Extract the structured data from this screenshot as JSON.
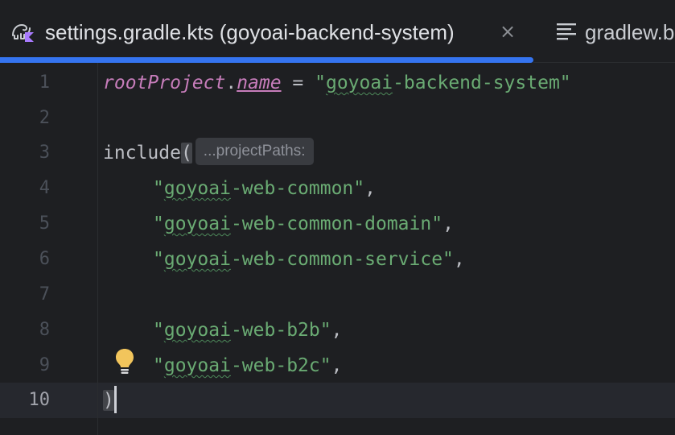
{
  "tabs": [
    {
      "title": "settings.gradle.kts (goyoai-backend-system)",
      "icon": "gradle-kotlin-icon",
      "active": true,
      "close": "×"
    },
    {
      "title": "gradlew.bat",
      "icon": "text-lines-icon",
      "active": false
    }
  ],
  "editor": {
    "current_line": 10,
    "lines": [
      {
        "number": "1"
      },
      {
        "number": "2"
      },
      {
        "number": "3"
      },
      {
        "number": "4"
      },
      {
        "number": "5"
      },
      {
        "number": "6"
      },
      {
        "number": "7"
      },
      {
        "number": "8"
      },
      {
        "number": "9"
      },
      {
        "number": "10"
      }
    ],
    "code": {
      "line1": {
        "root": "rootProject",
        "dot": ".",
        "prop": "name",
        "op": " = ",
        "str_open": "\"",
        "str_squig": "goyoai",
        "str_rest": "-backend-system\""
      },
      "line3": {
        "fn": "include",
        "paren": "(",
        "hint": "...projectPaths:"
      },
      "line4": {
        "q": "\"",
        "squig": "goyoai",
        "rest": "-web-common\"",
        "comma": ","
      },
      "line5": {
        "q": "\"",
        "squig": "goyoai",
        "rest": "-web-common-domain\"",
        "comma": ","
      },
      "line6": {
        "q": "\"",
        "squig": "goyoai",
        "rest": "-web-common-service\"",
        "comma": ","
      },
      "line8": {
        "q": "\"",
        "squig": "goyoai",
        "rest": "-web-b2b\"",
        "comma": ","
      },
      "line9": {
        "q": "\"",
        "squig": "goyoai",
        "rest": "-web-b2c\"",
        "comma": ","
      },
      "line10": {
        "paren": ")"
      }
    },
    "intention_icon": "lightbulb-icon"
  },
  "colors": {
    "accent": "#3574f0",
    "string": "#6aab73",
    "property": "#c77dbb",
    "bulb": "#f2c55c"
  }
}
